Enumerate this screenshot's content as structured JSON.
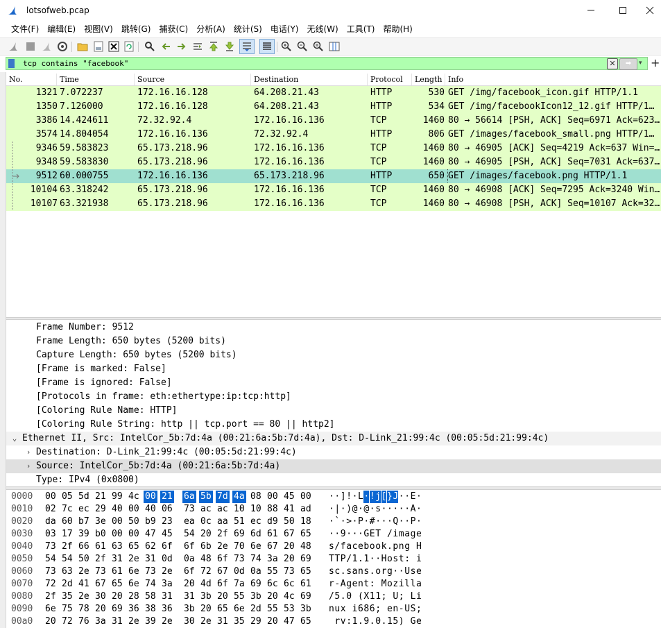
{
  "window": {
    "title": "lotsofweb.pcap"
  },
  "menu": [
    "文件(F)",
    "编辑(E)",
    "视图(V)",
    "跳转(G)",
    "捕获(C)",
    "分析(A)",
    "统计(S)",
    "电话(Y)",
    "无线(W)",
    "工具(T)",
    "帮助(H)"
  ],
  "filter": {
    "value": "tcp contains \"facebook\""
  },
  "columns": [
    "No.",
    "Time",
    "Source",
    "Destination",
    "Protocol",
    "Length",
    "Info"
  ],
  "packets": [
    {
      "no": "1321",
      "time": "7.072237",
      "src": "172.16.16.128",
      "dst": "64.208.21.43",
      "proto": "HTTP",
      "len": "530",
      "info": "GET /img/facebook_icon.gif HTTP/1.1"
    },
    {
      "no": "1350",
      "time": "7.126000",
      "src": "172.16.16.128",
      "dst": "64.208.21.43",
      "proto": "HTTP",
      "len": "534",
      "info": "GET /img/facebookIcon12_12.gif HTTP/1…"
    },
    {
      "no": "3386",
      "time": "14.424611",
      "src": "72.32.92.4",
      "dst": "172.16.16.136",
      "proto": "TCP",
      "len": "1460",
      "info": "80 → 56614 [PSH, ACK] Seq=6971 Ack=623…"
    },
    {
      "no": "3574",
      "time": "14.804054",
      "src": "172.16.16.136",
      "dst": "72.32.92.4",
      "proto": "HTTP",
      "len": "806",
      "info": "GET /images/facebook_small.png HTTP/1…"
    },
    {
      "no": "9346",
      "time": "59.583823",
      "src": "65.173.218.96",
      "dst": "172.16.16.136",
      "proto": "TCP",
      "len": "1460",
      "info": "80 → 46905 [ACK] Seq=4219 Ack=637 Win=…"
    },
    {
      "no": "9348",
      "time": "59.583830",
      "src": "65.173.218.96",
      "dst": "172.16.16.136",
      "proto": "TCP",
      "len": "1460",
      "info": "80 → 46905 [PSH, ACK] Seq=7031 Ack=637…"
    },
    {
      "no": "9512",
      "time": "60.000755",
      "src": "172.16.16.136",
      "dst": "65.173.218.96",
      "proto": "HTTP",
      "len": "650",
      "info": "GET /images/facebook.png HTTP/1.1"
    },
    {
      "no": "10104",
      "time": "63.318242",
      "src": "65.173.218.96",
      "dst": "172.16.16.136",
      "proto": "TCP",
      "len": "1460",
      "info": "80 → 46908 [ACK] Seq=7295 Ack=3240 Win…"
    },
    {
      "no": "10107",
      "time": "63.321938",
      "src": "65.173.218.96",
      "dst": "172.16.16.136",
      "proto": "TCP",
      "len": "1460",
      "info": "80 → 46908 [PSH, ACK] Seq=10107 Ack=32…"
    }
  ],
  "details": [
    {
      "indent": 1,
      "arrow": "",
      "text": "Frame Number: 9512"
    },
    {
      "indent": 1,
      "arrow": "",
      "text": "Frame Length: 650 bytes (5200 bits)"
    },
    {
      "indent": 1,
      "arrow": "",
      "text": "Capture Length: 650 bytes (5200 bits)"
    },
    {
      "indent": 1,
      "arrow": "",
      "text": "[Frame is marked: False]"
    },
    {
      "indent": 1,
      "arrow": "",
      "text": "[Frame is ignored: False]"
    },
    {
      "indent": 1,
      "arrow": "",
      "text": "[Protocols in frame: eth:ethertype:ip:tcp:http]"
    },
    {
      "indent": 1,
      "arrow": "",
      "text": "[Coloring Rule Name: HTTP]"
    },
    {
      "indent": 1,
      "arrow": "",
      "text": "[Coloring Rule String: http || tcp.port == 80 || http2]"
    },
    {
      "indent": 0,
      "arrow": "⌄",
      "text": "Ethernet II, Src: IntelCor_5b:7d:4a (00:21:6a:5b:7d:4a), Dst: D-Link_21:99:4c (00:05:5d:21:99:4c)"
    },
    {
      "indent": 1,
      "arrow": "›",
      "text": "Destination: D-Link_21:99:4c (00:05:5d:21:99:4c)"
    },
    {
      "indent": 1,
      "arrow": "›",
      "text": "Source: IntelCor_5b:7d:4a (00:21:6a:5b:7d:4a)"
    },
    {
      "indent": 1,
      "arrow": "",
      "text": "Type: IPv4 (0x0800)"
    }
  ],
  "bytes": [
    {
      "off": "0000",
      "hex": [
        "00",
        "05",
        "5d",
        "21",
        "99",
        "4c",
        "00",
        "21",
        "6a",
        "5b",
        "7d",
        "4a",
        "08",
        "00",
        "45",
        "00"
      ],
      "ascii": [
        "·",
        "·",
        "]",
        "!",
        "·",
        "L",
        "·",
        "!",
        "j",
        "[",
        "}",
        "J",
        "·",
        "·",
        "E",
        "·"
      ]
    },
    {
      "off": "0010",
      "hex": [
        "02",
        "7c",
        "ec",
        "29",
        "40",
        "00",
        "40",
        "06",
        "73",
        "ac",
        "ac",
        "10",
        "10",
        "88",
        "41",
        "ad"
      ],
      "ascii": [
        "·",
        "|",
        "·",
        ")",
        "@",
        "·",
        "@",
        "·",
        "s",
        "·",
        "·",
        "·",
        "·",
        "·",
        "A",
        "·"
      ]
    },
    {
      "off": "0020",
      "hex": [
        "da",
        "60",
        "b7",
        "3e",
        "00",
        "50",
        "b9",
        "23",
        "ea",
        "0c",
        "aa",
        "51",
        "ec",
        "d9",
        "50",
        "18"
      ],
      "ascii": [
        "·",
        "`",
        "·",
        ">",
        "·",
        "P",
        "·",
        "#",
        "·",
        "·",
        "·",
        "Q",
        "·",
        "·",
        "P",
        "·"
      ]
    },
    {
      "off": "0030",
      "hex": [
        "03",
        "17",
        "39",
        "b0",
        "00",
        "00",
        "47",
        "45",
        "54",
        "20",
        "2f",
        "69",
        "6d",
        "61",
        "67",
        "65"
      ],
      "ascii": [
        "·",
        "·",
        "9",
        "·",
        "·",
        "·",
        "G",
        "E",
        "T",
        " ",
        "/",
        "i",
        "m",
        "a",
        "g",
        "e"
      ]
    },
    {
      "off": "0040",
      "hex": [
        "73",
        "2f",
        "66",
        "61",
        "63",
        "65",
        "62",
        "6f",
        "6f",
        "6b",
        "2e",
        "70",
        "6e",
        "67",
        "20",
        "48"
      ],
      "ascii": [
        "s",
        "/",
        "f",
        "a",
        "c",
        "e",
        "b",
        "o",
        "o",
        "k",
        ".",
        "p",
        "n",
        "g",
        " ",
        "H"
      ]
    },
    {
      "off": "0050",
      "hex": [
        "54",
        "54",
        "50",
        "2f",
        "31",
        "2e",
        "31",
        "0d",
        "0a",
        "48",
        "6f",
        "73",
        "74",
        "3a",
        "20",
        "69"
      ],
      "ascii": [
        "T",
        "T",
        "P",
        "/",
        "1",
        ".",
        "1",
        "·",
        "·",
        "H",
        "o",
        "s",
        "t",
        ":",
        " ",
        "i"
      ]
    },
    {
      "off": "0060",
      "hex": [
        "73",
        "63",
        "2e",
        "73",
        "61",
        "6e",
        "73",
        "2e",
        "6f",
        "72",
        "67",
        "0d",
        "0a",
        "55",
        "73",
        "65"
      ],
      "ascii": [
        "s",
        "c",
        ".",
        "s",
        "a",
        "n",
        "s",
        ".",
        "o",
        "r",
        "g",
        "·",
        "·",
        "U",
        "s",
        "e"
      ]
    },
    {
      "off": "0070",
      "hex": [
        "72",
        "2d",
        "41",
        "67",
        "65",
        "6e",
        "74",
        "3a",
        "20",
        "4d",
        "6f",
        "7a",
        "69",
        "6c",
        "6c",
        "61"
      ],
      "ascii": [
        "r",
        "-",
        "A",
        "g",
        "e",
        "n",
        "t",
        ":",
        " ",
        "M",
        "o",
        "z",
        "i",
        "l",
        "l",
        "a"
      ]
    },
    {
      "off": "0080",
      "hex": [
        "2f",
        "35",
        "2e",
        "30",
        "20",
        "28",
        "58",
        "31",
        "31",
        "3b",
        "20",
        "55",
        "3b",
        "20",
        "4c",
        "69"
      ],
      "ascii": [
        "/",
        "5",
        ".",
        "0",
        " ",
        "(",
        "X",
        "1",
        "1",
        ";",
        " ",
        "U",
        ";",
        " ",
        "L",
        "i"
      ]
    },
    {
      "off": "0090",
      "hex": [
        "6e",
        "75",
        "78",
        "20",
        "69",
        "36",
        "38",
        "36",
        "3b",
        "20",
        "65",
        "6e",
        "2d",
        "55",
        "53",
        "3b"
      ],
      "ascii": [
        "n",
        "u",
        "x",
        " ",
        "i",
        "6",
        "8",
        "6",
        ";",
        " ",
        "e",
        "n",
        "-",
        "U",
        "S",
        ";"
      ]
    },
    {
      "off": "00a0",
      "hex": [
        "20",
        "72",
        "76",
        "3a",
        "31",
        "2e",
        "39",
        "2e",
        "30",
        "2e",
        "31",
        "35",
        "29",
        "20",
        "47",
        "65"
      ],
      "ascii": [
        " ",
        "r",
        "v",
        ":",
        "1",
        ".",
        "9",
        ".",
        "0",
        ".",
        "1",
        "5",
        ")",
        " ",
        "G",
        "e"
      ]
    }
  ],
  "colors": {
    "http_row": "#e4ffc7",
    "tcp_row": "#e4ffc7",
    "selected_row": "#a0e0d0",
    "filter_ok": "#afffaf",
    "byte_highlight": "#0a66d2"
  }
}
